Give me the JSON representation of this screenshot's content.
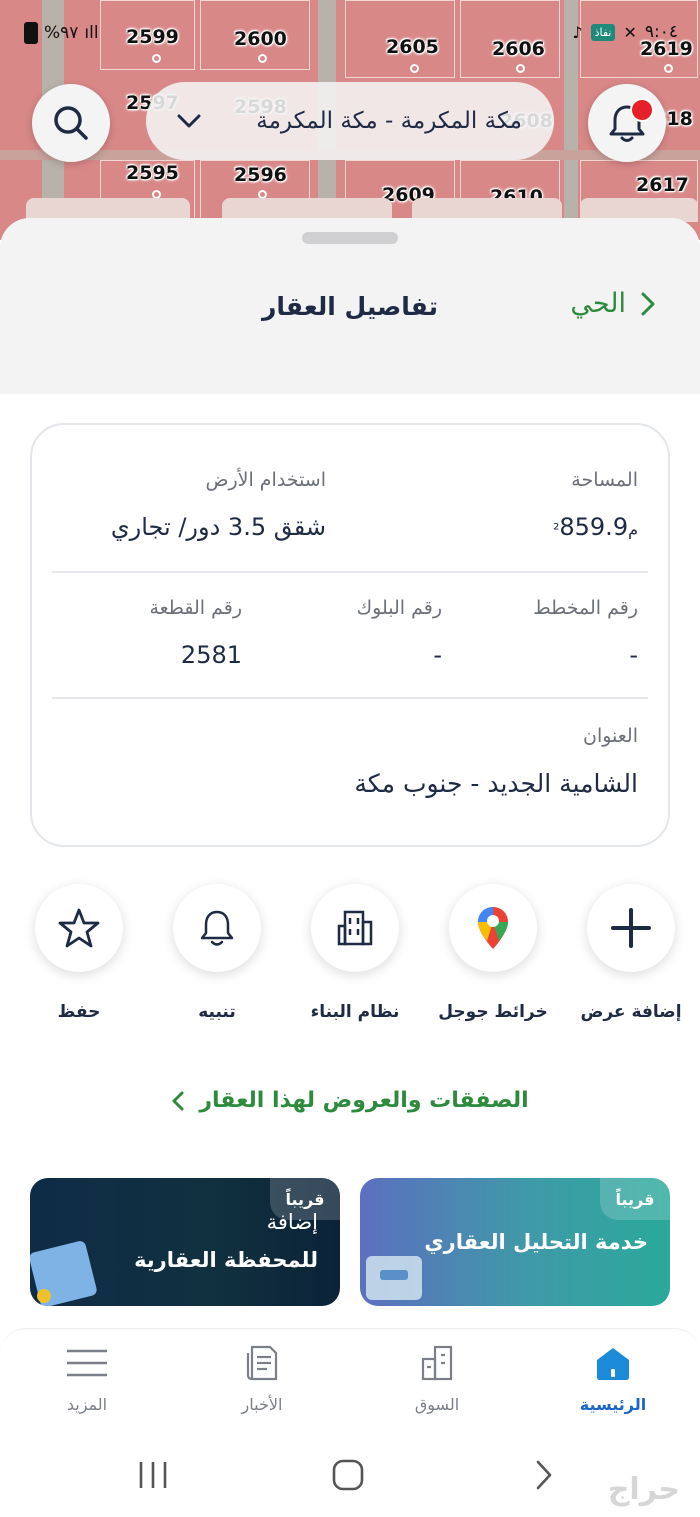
{
  "status_bar": {
    "battery_text": "%٩٧",
    "signal_text": "ıll",
    "right_chip": "نفاذ",
    "right_text": "٩:٠٤"
  },
  "map": {
    "plots": [
      "2599",
      "2600",
      "2605",
      "2606",
      "2619",
      "2597",
      "2598",
      "2608",
      "2618",
      "2595",
      "2596",
      "2609",
      "2610",
      "2617"
    ]
  },
  "header": {
    "city_selector": "مكة المكرمة - مكة المكرمة"
  },
  "sheet": {
    "title": "تفاصيل العقار",
    "back_label": "الحي"
  },
  "details": {
    "area_label": "المساحة",
    "area_value": "859.9",
    "area_unit": "م²",
    "land_use_label": "استخدام الأرض",
    "land_use_value": "شقق 3.5 دور/ تجاري",
    "plan_label": "رقم المخطط",
    "plan_value": "-",
    "block_label": "رقم البلوك",
    "block_value": "-",
    "parcel_label": "رقم القطعة",
    "parcel_value": "2581",
    "address_label": "العنوان",
    "address_value": "الشامية الجديد - جنوب مكة"
  },
  "actions": {
    "add_offer": "إضافة عرض",
    "google_maps": "خرائط جوجل",
    "building_code": "نظام البناء",
    "alert": "تنبيه",
    "save": "حفظ"
  },
  "deals_link": "الصفقات والعروض لهذا العقار",
  "promos": {
    "analysis": {
      "badge": "قريباً",
      "title": "خدمة التحليل العقاري"
    },
    "portfolio": {
      "badge": "قريباً",
      "title_line1": "إضافة",
      "title_line2": "للمحفظة العقارية"
    }
  },
  "bottom_nav": {
    "home": "الرئيسية",
    "market": "السوق",
    "news": "الأخبار",
    "more": "المزيد"
  },
  "watermark": "حراج",
  "colors": {
    "accent_green": "#2e8b3e",
    "accent_blue": "#1b67c8",
    "text_dark": "#1f2a44",
    "map_parcel": "#d98888",
    "notification_red": "#e5202a"
  }
}
